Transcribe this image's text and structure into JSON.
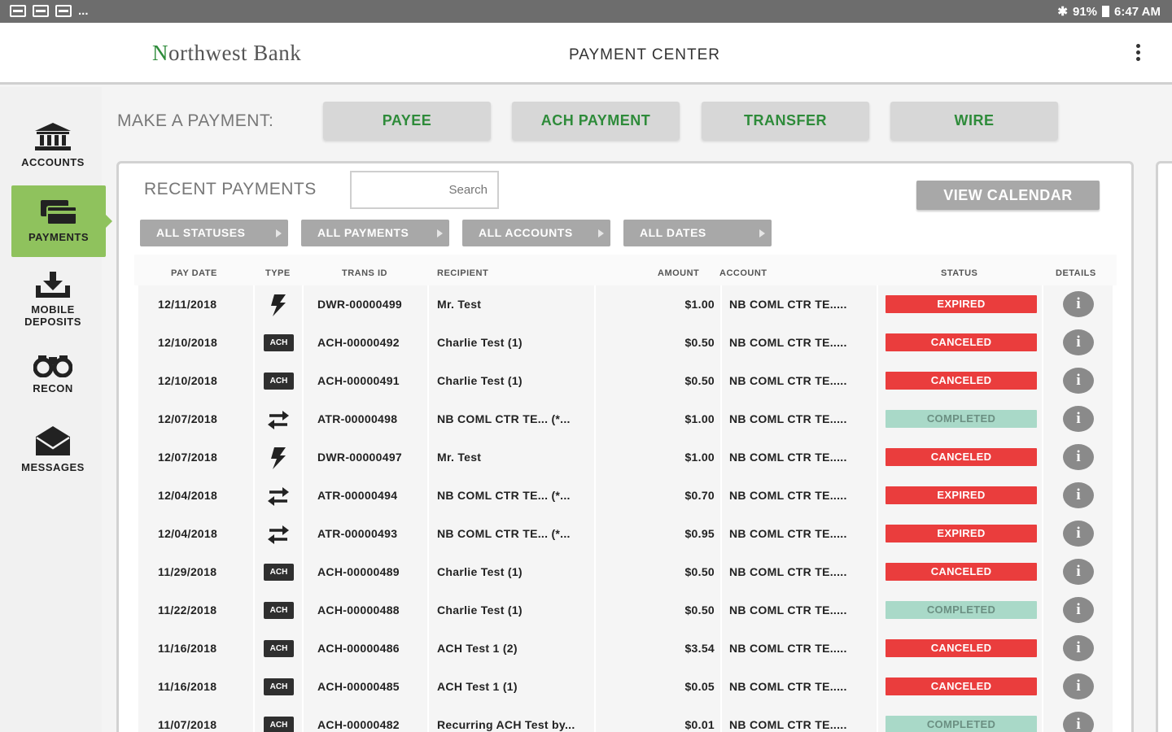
{
  "status_bar": {
    "left_text": "...",
    "battery": "91%",
    "time": "6:47 AM"
  },
  "header": {
    "logo_first": "N",
    "logo_rest": "orthwest Bank",
    "title": "PAYMENT CENTER"
  },
  "sidebar": {
    "items": [
      {
        "label": "ACCOUNTS",
        "icon": "bank-icon"
      },
      {
        "label": "PAYMENTS",
        "icon": "card-icon",
        "active": true
      },
      {
        "label1": "MOBILE",
        "label2": "DEPOSITS",
        "icon": "download-tray-icon"
      },
      {
        "label": "RECON",
        "icon": "binoculars-icon"
      },
      {
        "label": "MESSAGES",
        "icon": "envelope-icon"
      }
    ]
  },
  "make_payment": {
    "label": "MAKE A PAYMENT:",
    "buttons": [
      "PAYEE",
      "ACH PAYMENT",
      "TRANSFER",
      "WIRE"
    ]
  },
  "recent": {
    "label": "RECENT PAYMENTS",
    "search_placeholder": "Search",
    "view_calendar": "VIEW CALENDAR",
    "filters": [
      "ALL STATUSES",
      "ALL PAYMENTS",
      "ALL ACCOUNTS",
      "ALL DATES"
    ]
  },
  "table": {
    "headers": [
      "PAY DATE",
      "TYPE",
      "TRANS ID",
      "RECIPIENT",
      "AMOUNT",
      "ACCOUNT",
      "STATUS",
      "DETAILS"
    ],
    "rows": [
      {
        "date": "12/11/2018",
        "type": "wire",
        "id": "DWR-00000499",
        "recipient": "Mr. Test",
        "amount": "$1.00",
        "account": "NB COML CTR TE.....",
        "status": "EXPIRED",
        "status_color": "red"
      },
      {
        "date": "12/10/2018",
        "type": "ach",
        "id": "ACH-00000492",
        "recipient": "Charlie Test (1)",
        "amount": "$0.50",
        "account": "NB COML CTR TE.....",
        "status": "CANCELED",
        "status_color": "red"
      },
      {
        "date": "12/10/2018",
        "type": "ach",
        "id": "ACH-00000491",
        "recipient": "Charlie Test (1)",
        "amount": "$0.50",
        "account": "NB COML CTR TE.....",
        "status": "CANCELED",
        "status_color": "red"
      },
      {
        "date": "12/07/2018",
        "type": "transfer",
        "id": "ATR-00000498",
        "recipient": "NB COML CTR TE... (*...",
        "amount": "$1.00",
        "account": "NB COML CTR TE.....",
        "status": "COMPLETED",
        "status_color": "green"
      },
      {
        "date": "12/07/2018",
        "type": "wire",
        "id": "DWR-00000497",
        "recipient": "Mr. Test",
        "amount": "$1.00",
        "account": "NB COML CTR TE.....",
        "status": "CANCELED",
        "status_color": "red"
      },
      {
        "date": "12/04/2018",
        "type": "transfer",
        "id": "ATR-00000494",
        "recipient": "NB COML CTR TE... (*...",
        "amount": "$0.70",
        "account": "NB COML CTR TE.....",
        "status": "EXPIRED",
        "status_color": "red"
      },
      {
        "date": "12/04/2018",
        "type": "transfer",
        "id": "ATR-00000493",
        "recipient": "NB COML CTR TE... (*...",
        "amount": "$0.95",
        "account": "NB COML CTR TE.....",
        "status": "EXPIRED",
        "status_color": "red"
      },
      {
        "date": "11/29/2018",
        "type": "ach",
        "id": "ACH-00000489",
        "recipient": "Charlie Test (1)",
        "amount": "$0.50",
        "account": "NB COML CTR TE.....",
        "status": "CANCELED",
        "status_color": "red"
      },
      {
        "date": "11/22/2018",
        "type": "ach",
        "id": "ACH-00000488",
        "recipient": "Charlie Test (1)",
        "amount": "$0.50",
        "account": "NB COML CTR TE.....",
        "status": "COMPLETED",
        "status_color": "green"
      },
      {
        "date": "11/16/2018",
        "type": "ach",
        "id": "ACH-00000486",
        "recipient": "ACH Test 1 (2)",
        "amount": "$3.54",
        "account": "NB COML CTR TE.....",
        "status": "CANCELED",
        "status_color": "red"
      },
      {
        "date": "11/16/2018",
        "type": "ach",
        "id": "ACH-00000485",
        "recipient": "ACH Test 1 (1)",
        "amount": "$0.05",
        "account": "NB COML CTR TE.....",
        "status": "CANCELED",
        "status_color": "red"
      },
      {
        "date": "11/07/2018",
        "type": "ach",
        "id": "ACH-00000482",
        "recipient": "Recurring ACH Test by...",
        "amount": "$0.01",
        "account": "NB COML CTR TE.....",
        "status": "COMPLETED",
        "status_color": "green"
      }
    ],
    "ach_badge": "ACH",
    "info_glyph": "i"
  },
  "colors": {
    "brand_green": "#2e8b3a",
    "active_nav": "#8fc25d",
    "status_red": "#ea3d3d",
    "status_green": "#a9d9c8"
  }
}
